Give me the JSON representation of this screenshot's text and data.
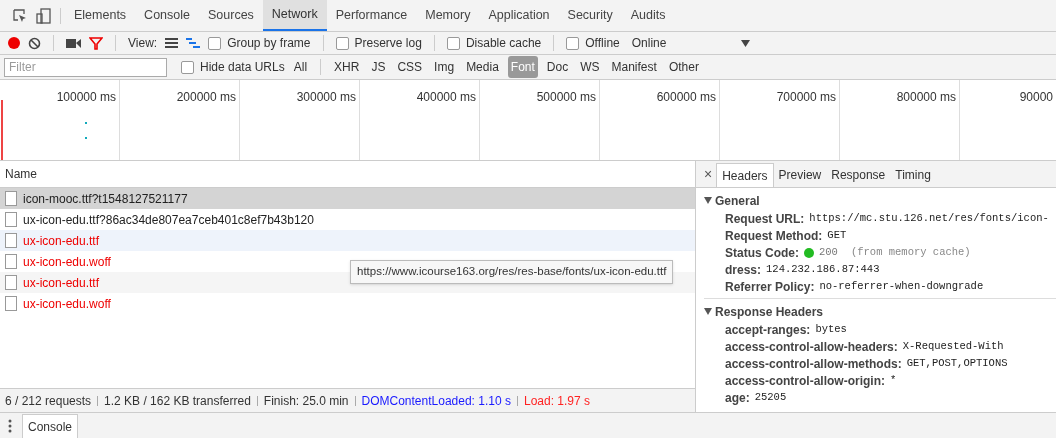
{
  "panel_tabs": [
    {
      "label": "Elements",
      "selected": false
    },
    {
      "label": "Console",
      "selected": false
    },
    {
      "label": "Sources",
      "selected": false
    },
    {
      "label": "Network",
      "selected": true
    },
    {
      "label": "Performance",
      "selected": false
    },
    {
      "label": "Memory",
      "selected": false
    },
    {
      "label": "Application",
      "selected": false
    },
    {
      "label": "Security",
      "selected": false
    },
    {
      "label": "Audits",
      "selected": false
    }
  ],
  "toolbar": {
    "recording": true,
    "filter_on": true,
    "view_label": "View:",
    "checkboxes": [
      {
        "label": "Group by frame",
        "checked": false
      },
      {
        "label": "Preserve log",
        "checked": false
      },
      {
        "label": "Disable cache",
        "checked": false
      },
      {
        "label": "Offline",
        "checked": false
      }
    ],
    "throttle": "Online"
  },
  "filter_bar": {
    "placeholder": "Filter",
    "hide_data_urls": {
      "label": "Hide data URLs",
      "checked": false
    },
    "types": [
      {
        "label": "All",
        "selected": false
      },
      {
        "label": "XHR",
        "selected": false
      },
      {
        "label": "JS",
        "selected": false
      },
      {
        "label": "CSS",
        "selected": false
      },
      {
        "label": "Img",
        "selected": false
      },
      {
        "label": "Media",
        "selected": false
      },
      {
        "label": "Font",
        "selected": true
      },
      {
        "label": "Doc",
        "selected": false
      },
      {
        "label": "WS",
        "selected": false
      },
      {
        "label": "Manifest",
        "selected": false
      },
      {
        "label": "Other",
        "selected": false
      }
    ]
  },
  "timeline": {
    "ticks": [
      "100000 ms",
      "200000 ms",
      "300000 ms",
      "400000 ms",
      "500000 ms",
      "600000 ms",
      "700000 ms",
      "800000 ms",
      "90000"
    ]
  },
  "requests": {
    "column": "Name",
    "rows": [
      {
        "name": "icon-mooc.ttf?t1548127521177",
        "selected": true,
        "failed": false,
        "hovered": false
      },
      {
        "name": "ux-icon-edu.ttf?86ac34de807ea7ceb401c8ef7b43b120",
        "selected": false,
        "failed": false,
        "hovered": false
      },
      {
        "name": "ux-icon-edu.ttf",
        "selected": false,
        "failed": true,
        "hovered": true
      },
      {
        "name": "ux-icon-edu.woff",
        "selected": false,
        "failed": true,
        "hovered": false
      },
      {
        "name": "ux-icon-edu.ttf",
        "selected": false,
        "failed": true,
        "hovered": false
      },
      {
        "name": "ux-icon-edu.woff",
        "selected": false,
        "failed": true,
        "hovered": false
      }
    ]
  },
  "tooltip": "https://www.icourse163.org/res/res-base/fonts/ux-icon-edu.ttf",
  "details": {
    "close": "×",
    "tabs": [
      {
        "label": "Headers",
        "selected": true
      },
      {
        "label": "Preview",
        "selected": false
      },
      {
        "label": "Response",
        "selected": false
      },
      {
        "label": "Timing",
        "selected": false
      }
    ],
    "sections": [
      {
        "title": "General",
        "expanded": true,
        "rows": [
          {
            "key": "Request URL:",
            "value": "https://mc.stu.126.net/res/fonts/icon-"
          },
          {
            "key": "Request Method:",
            "value": "GET"
          },
          {
            "key": "Status Code:",
            "value": "200",
            "note": "(from memory cache)",
            "color": "#22bb22"
          },
          {
            "key": "dress:",
            "value": "124.232.186.87:443"
          },
          {
            "key": "Referrer Policy:",
            "value": "no-referrer-when-downgrade"
          }
        ]
      },
      {
        "title": "Response Headers",
        "expanded": true,
        "rows": [
          {
            "key": "accept-ranges:",
            "value": "bytes"
          },
          {
            "key": "access-control-allow-headers:",
            "value": "X-Requested-With"
          },
          {
            "key": "access-control-allow-methods:",
            "value": "GET,POST,OPTIONS"
          },
          {
            "key": "access-control-allow-origin:",
            "value": "*"
          },
          {
            "key": "age:",
            "value": "25205"
          }
        ]
      }
    ]
  },
  "status_bar": [
    {
      "text": "6 / 212 requests",
      "kind": "plain"
    },
    {
      "text": "1.2 KB / 162 KB transferred",
      "kind": "plain"
    },
    {
      "text": "Finish: 25.0 min",
      "kind": "plain"
    },
    {
      "text": "DOMContentLoaded: 1.10 s",
      "kind": "dom"
    },
    {
      "text": "Load: 1.97 s",
      "kind": "load"
    }
  ],
  "drawer": {
    "tabs": [
      {
        "label": "Console",
        "selected": true
      }
    ]
  }
}
